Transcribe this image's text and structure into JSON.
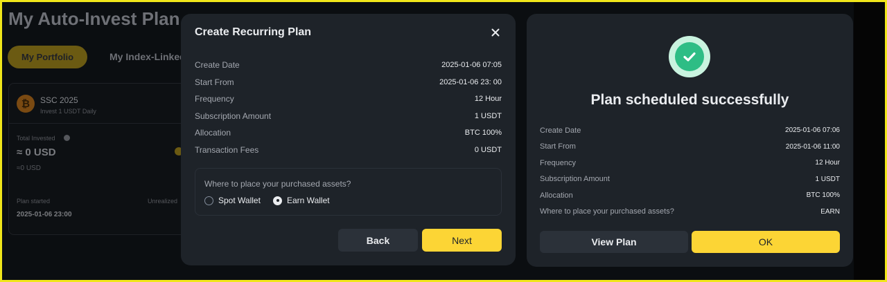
{
  "background": {
    "page_title": "My Auto-Invest Plan",
    "tabs": [
      "My Portfolio",
      "My Index-Linked"
    ],
    "card": {
      "coin_symbol": "₿",
      "plan_name": "SSC 2025",
      "plan_sub": "Invest 1 USDT Daily",
      "total_invested_label": "Total Invested",
      "total_invested": "≈ 0 USD",
      "total_invested_sub": "≈0 USD",
      "plan_started_label": "Plan started",
      "unrealized_label": "Unrealized",
      "plan_started": "2025-01-06 23:00"
    }
  },
  "create_modal": {
    "title": "Create Recurring Plan",
    "close_icon": "close-icon",
    "rows": [
      {
        "label": "Create Date",
        "value": "2025-01-06 07:05"
      },
      {
        "label": "Start From",
        "value": "2025-01-06 23: 00"
      },
      {
        "label": "Frequency",
        "value": "12 Hour"
      },
      {
        "label": "Subscription Amount",
        "value": "1 USDT"
      },
      {
        "label": "Allocation",
        "value": "BTC 100%"
      },
      {
        "label": "Transaction Fees",
        "value": "0 USDT"
      }
    ],
    "placement_question": "Where to place your purchased assets?",
    "options": [
      {
        "label": "Spot Wallet",
        "selected": false
      },
      {
        "label": "Earn Wallet",
        "selected": true
      }
    ],
    "back_label": "Back",
    "next_label": "Next"
  },
  "success_modal": {
    "icon": "check-circle-icon",
    "title": "Plan scheduled successfully",
    "rows": [
      {
        "label": "Create Date",
        "value": "2025-01-06 07:06"
      },
      {
        "label": "Start From",
        "value": "2025-01-06 11:00"
      },
      {
        "label": "Frequency",
        "value": "12 Hour"
      },
      {
        "label": "Subscription Amount",
        "value": "1 USDT"
      },
      {
        "label": "Allocation",
        "value": "BTC 100%"
      },
      {
        "label": "Where to place your purchased assets?",
        "value": "EARN"
      }
    ],
    "view_plan_label": "View Plan",
    "ok_label": "OK"
  },
  "colors": {
    "accent": "#fcd535",
    "modal_bg": "#1e2329",
    "success": "#2ebd85",
    "frame": "#f0e61a"
  }
}
